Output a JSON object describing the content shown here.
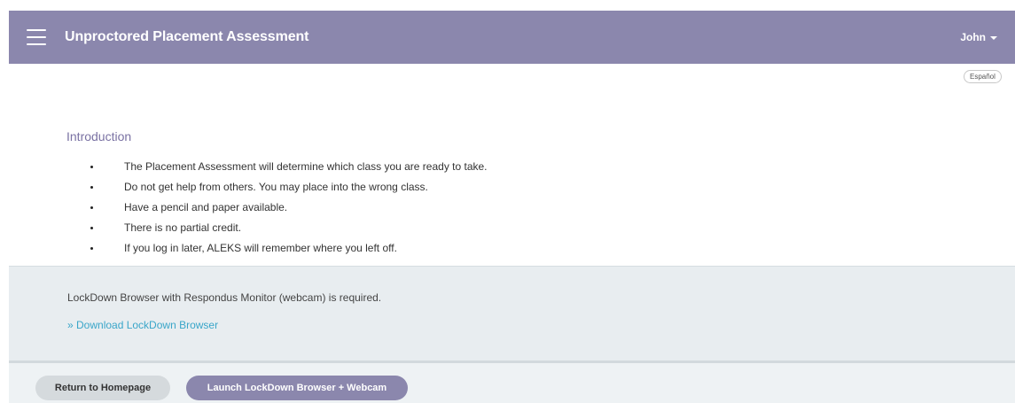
{
  "header": {
    "title": "Unproctored Placement Assessment",
    "user": "John",
    "menu_icon": "hamburger-menu-icon"
  },
  "language_button": "Español",
  "intro": {
    "heading": "Introduction",
    "bullets": [
      "The Placement Assessment will determine which class you are ready to take.",
      "Do not get help from others. You may place into the wrong class.",
      "Have a pencil and paper available.",
      "There is no partial credit.",
      "If you log in later, ALEKS will remember where you left off."
    ]
  },
  "lockdown": {
    "note": "LockDown Browser with Respondus Monitor (webcam) is required.",
    "download_link": "» Download LockDown Browser"
  },
  "footer": {
    "return_button": "Return to Homepage",
    "launch_button": "Launch LockDown Browser + Webcam"
  },
  "colors": {
    "header_bg": "#8b87ad",
    "intro_heading": "#7a72a3",
    "link": "#3aa6c9",
    "panel_bg": "#e8edf0"
  }
}
